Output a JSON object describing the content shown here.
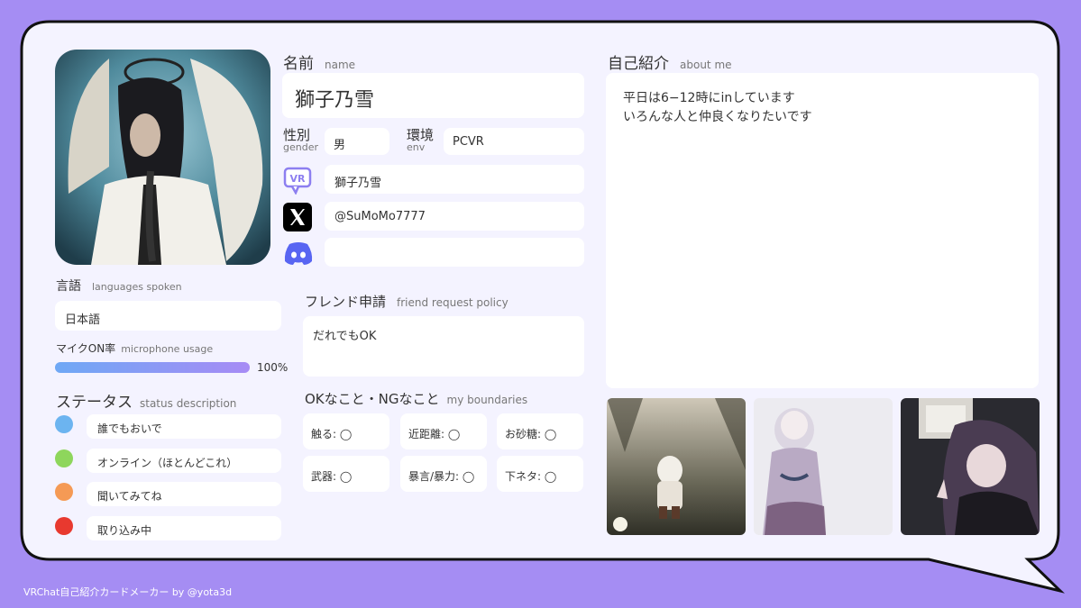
{
  "name": {
    "heading": "名前",
    "sub": "name",
    "value": "獅子乃雪"
  },
  "gender": {
    "label": "性別",
    "sub": "gender",
    "value": "男"
  },
  "env": {
    "label": "環境",
    "sub": "env",
    "value": "PCVR"
  },
  "accounts": {
    "vrchat": "獅子乃雪",
    "x": "@SuMoMo7777",
    "discord": "",
    "vr_badge": "VR"
  },
  "about": {
    "heading": "自己紹介",
    "sub": "about me",
    "line1": "平日は6−12時にinしています",
    "line2": "いろんな人と仲良くなりたいです"
  },
  "languages": {
    "heading": "言語",
    "sub": "languages spoken",
    "value": "日本語"
  },
  "mic": {
    "label": "マイクON率",
    "sub": "microphone usage",
    "percent": 100,
    "percent_text": "100%"
  },
  "status": {
    "heading": "ステータス",
    "sub": "status description",
    "items": [
      {
        "label": "誰でもおいで",
        "color": "#6cb4f0"
      },
      {
        "label": "オンライン（ほとんどこれ）",
        "color": "#8ed65c"
      },
      {
        "label": "聞いてみてね",
        "color": "#f59a55"
      },
      {
        "label": "取り込み中",
        "color": "#e8392f"
      }
    ]
  },
  "friend": {
    "heading": "フレンド申請",
    "sub": "friend request policy",
    "value": "だれでもOK"
  },
  "boundaries": {
    "heading": "OKなこと・NGなこと",
    "sub": "my boundaries",
    "items": [
      "触る: ◯",
      "近距離: ◯",
      "お砂糖: ◯",
      "武器: ◯",
      "暴言/暴力: ◯",
      "下ネタ: ◯"
    ]
  },
  "footer": "VRChat自己紹介カードメーカー by @yota3d",
  "colors": {
    "background": "#a58df3",
    "card": "#f4f3ff",
    "mic_bar_start": "#6ea8f5",
    "mic_bar_end": "#a78bf5"
  }
}
